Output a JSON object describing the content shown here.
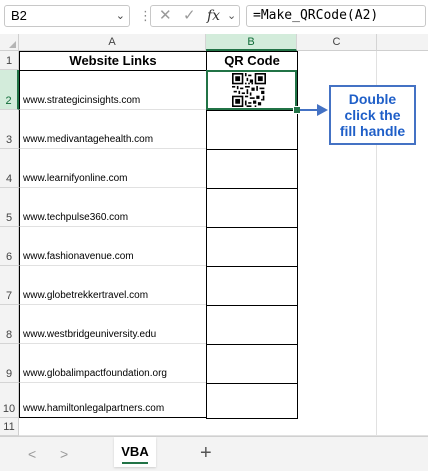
{
  "formula_bar": {
    "name_box": "B2",
    "cancel_icon": "✕",
    "enter_icon": "✓",
    "fx_label": "fx",
    "formula": "=Make_QRCode(A2)"
  },
  "columns": [
    "A",
    "B",
    "C"
  ],
  "rows": [
    "1",
    "2",
    "3",
    "4",
    "5",
    "6",
    "7",
    "8",
    "9",
    "10",
    "11"
  ],
  "sheet": {
    "header_a": "Website Links",
    "header_b": "QR Code",
    "links": [
      "www.strategicinsights.com",
      "www.medivantagehealth.com",
      "www.learnifyonline.com",
      "www.techpulse360.com",
      "www.fashionavenue.com",
      "www.globetrekkertravel.com",
      "www.westbridgeuniversity.edu",
      "www.globalimpactfoundation.org",
      "www.hamiltonlegalpartners.com"
    ]
  },
  "callout": {
    "line1": "Double",
    "line2": "click the",
    "line3": "fill handle"
  },
  "accent_color": "#217346",
  "callout_color": "#4472c4",
  "tabs": {
    "prev": "<",
    "next": ">",
    "active": "VBA",
    "add": "+"
  }
}
